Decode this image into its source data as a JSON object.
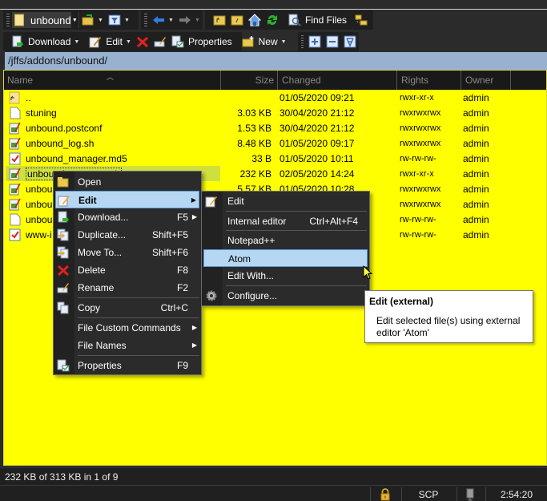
{
  "toolbar1": {
    "location_combo": "unbound",
    "find_files_label": "Find Files"
  },
  "toolbar2": {
    "download_label": "Download",
    "edit_label": "Edit",
    "properties_label": "Properties",
    "new_label": "New"
  },
  "path": "/jffs/addons/unbound/",
  "columns": {
    "name": "Name",
    "size": "Size",
    "changed": "Changed",
    "rights": "Rights",
    "owner": "Owner"
  },
  "files": [
    {
      "name": "..",
      "size": "",
      "changed": "01/05/2020 09:21",
      "rights": "rwxr-xr-x",
      "owner": "admin",
      "icon": "parent-folder-icon"
    },
    {
      "name": "stuning",
      "size": "3.03 KB",
      "changed": "30/04/2020 21:12",
      "rights": "rwxrwxrwx",
      "owner": "admin",
      "icon": "file-icon"
    },
    {
      "name": "unbound.postconf",
      "size": "1.53 KB",
      "changed": "30/04/2020 21:12",
      "rights": "rwxrwxrwx",
      "owner": "admin",
      "icon": "script-file-icon"
    },
    {
      "name": "unbound_log.sh",
      "size": "8.48 KB",
      "changed": "01/05/2020 09:17",
      "rights": "rwxrwxrwx",
      "owner": "admin",
      "icon": "script-file-icon"
    },
    {
      "name": "unbound_manager.md5",
      "size": "33 B",
      "changed": "01/05/2020 10:11",
      "rights": "rw-rw-rw-",
      "owner": "admin",
      "icon": "checksum-file-icon"
    },
    {
      "name": "unbound_manager.sh",
      "size": "232 KB",
      "changed": "02/05/2020 14:24",
      "rights": "rwxr-xr-x",
      "owner": "admin",
      "icon": "script-file-icon",
      "selected": true
    },
    {
      "name": "unbou",
      "size": "5.57 KB",
      "changed": "01/05/2020 10:28",
      "rights": "rwxrwxrwx",
      "owner": "admin",
      "icon": "script-file-icon"
    },
    {
      "name": "unbou",
      "size": "",
      "changed": "",
      "rights": "rwxrwxrwx",
      "owner": "admin",
      "icon": "script-file-icon"
    },
    {
      "name": "unbou",
      "size": "",
      "changed": "",
      "rights": "rw-rw-rw-",
      "owner": "admin",
      "icon": "file-icon"
    },
    {
      "name": "www-i",
      "size": "",
      "changed": "",
      "rights": "rw-rw-rw-",
      "owner": "admin",
      "icon": "checksum-file-icon"
    }
  ],
  "context_menu": {
    "items": [
      {
        "label": "Open",
        "shortcut": ""
      },
      {
        "label": "Edit",
        "shortcut": ""
      },
      {
        "label": "Download...",
        "shortcut": "F5"
      },
      {
        "label": "Duplicate...",
        "shortcut": "Shift+F5"
      },
      {
        "label": "Move To...",
        "shortcut": "Shift+F6"
      },
      {
        "label": "Delete",
        "shortcut": "F8"
      },
      {
        "label": "Rename",
        "shortcut": "F2"
      },
      {
        "label": "Copy",
        "shortcut": "Ctrl+C"
      },
      {
        "label": "File Custom Commands",
        "shortcut": ""
      },
      {
        "label": "File Names",
        "shortcut": ""
      },
      {
        "label": "Properties",
        "shortcut": "F9"
      }
    ]
  },
  "submenu": {
    "items": [
      {
        "label": "Edit",
        "shortcut": ""
      },
      {
        "label": "Internal editor",
        "shortcut": "Ctrl+Alt+F4"
      },
      {
        "label": "Notepad++",
        "shortcut": ""
      },
      {
        "label": "Atom",
        "shortcut": ""
      },
      {
        "label": "Edit With...",
        "shortcut": ""
      },
      {
        "label": "Configure...",
        "shortcut": ""
      }
    ]
  },
  "tooltip": {
    "title": "Edit (external)",
    "body": "Edit selected file(s) using external editor 'Atom'"
  },
  "status": {
    "selection": "232 KB of 313 KB in 1 of 9",
    "protocol": "SCP",
    "time": "2:54:20"
  }
}
